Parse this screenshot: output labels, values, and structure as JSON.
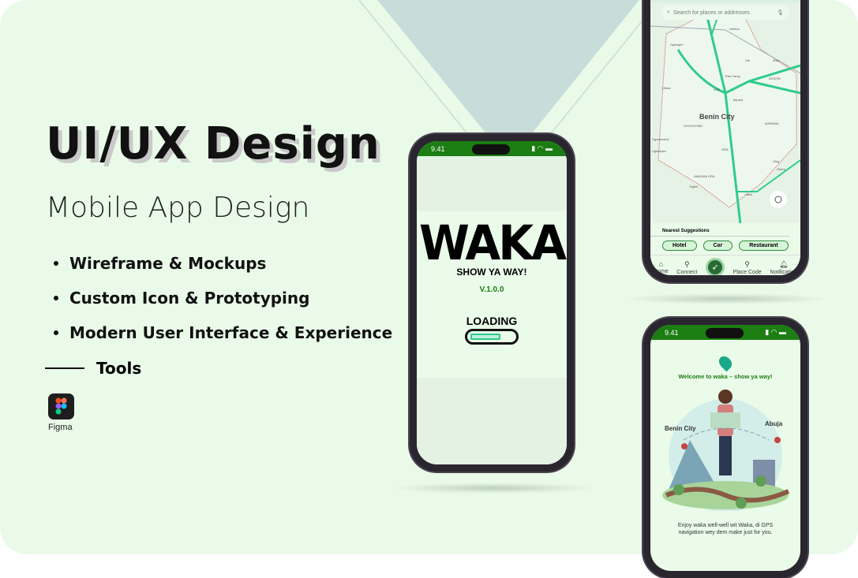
{
  "hero": {
    "title": "UI/UX Design",
    "subtitle": "Mobile App Design",
    "bullets": [
      "Wireframe & Mockups",
      "Custom Icon & Prototyping",
      "Modern User Interface & Experience"
    ],
    "tools_label": "Tools",
    "tool_name": "Figma"
  },
  "loading_screen": {
    "time": "9.41",
    "logo": "WAKA",
    "tagline": "SHOW YA WAY!",
    "version": "V.1.0.0",
    "loading": "LOADING",
    "progress": 0.7
  },
  "map_screen": {
    "search_placeholder": "Search for places or addresses",
    "city": "Benin City",
    "places": [
      "Ekiadolor",
      "Uhekor",
      "Ogheghe",
      "Ute",
      "Anor",
      "Edo Camp",
      "IDOKPA",
      "USE",
      "Utoka",
      "Ikpoba",
      "OGOGUGBO",
      "Ogurunweyi",
      "AVBIAMA",
      "Ugbekpen",
      "ORA",
      "Uleg",
      "Ohere",
      "AMAGBA GRA",
      "Egbiri",
      "Utesi"
    ],
    "section_title": "Nearest Suggestions",
    "chips": [
      "Hotel",
      "Car",
      "Restaurant"
    ],
    "nav": [
      "Home",
      "Connect",
      "Place Code",
      "Notification"
    ]
  },
  "welcome_screen": {
    "time": "9.41",
    "heading": "Welcome to waka – show ya way!",
    "from": "Benin City",
    "to": "Abuja",
    "body": "Enjoy waka well-well wit Waka, di GPS navigation wey dem make just for you."
  },
  "colors": {
    "bg": "#e9fbe8",
    "green": "#1b7d12",
    "accent": "#2ecc8a"
  }
}
